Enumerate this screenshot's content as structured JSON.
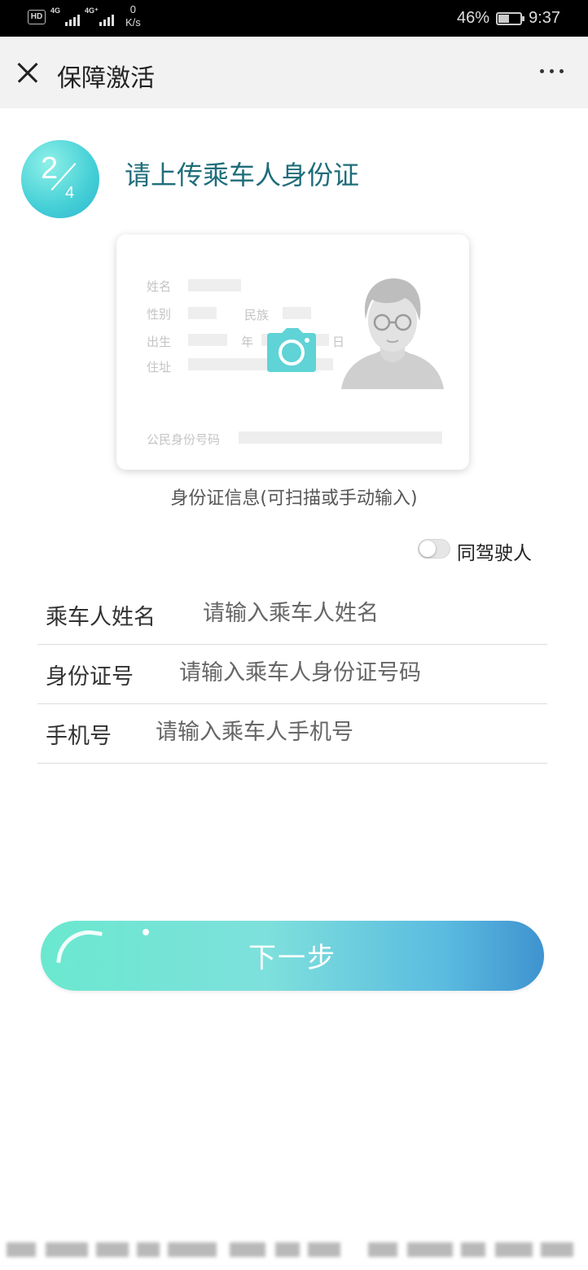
{
  "status_bar": {
    "hd": "HD",
    "sim1": "4G",
    "sim2": "4G⁺",
    "speed_value": "0",
    "speed_unit": "K/s",
    "battery": "46%",
    "battery_level": 0.46,
    "time": "9:37"
  },
  "nav": {
    "title": "保障激活",
    "close_icon": "close-icon",
    "more_icon": "more-icon"
  },
  "step": {
    "current": "2",
    "total": "4",
    "title": "请上传乘车人身份证"
  },
  "id_card": {
    "name_label": "姓名",
    "gender_label": "性别",
    "ethnicity_label": "民族",
    "birth_label": "出生",
    "year_label": "年",
    "day_label": "日",
    "address_label": "住址",
    "id_number_label": "公民身份号码",
    "camera_icon": "camera-icon",
    "portrait_icon": "portrait-icon",
    "accent_color": "#5fd3d6"
  },
  "card_caption": "身份证信息(可扫描或手动输入)",
  "same_driver": {
    "label": "同驾驶人",
    "on": false
  },
  "form": {
    "name": {
      "label": "乘车人姓名",
      "placeholder": "请输入乘车人姓名",
      "value": ""
    },
    "id_number": {
      "label": "身份证号",
      "placeholder": "请输入乘车人身份证号码",
      "value": ""
    },
    "phone": {
      "label": "手机号",
      "placeholder": "请输入乘车人手机号",
      "value": ""
    }
  },
  "next_button": {
    "label": "下一步"
  },
  "colors": {
    "title_teal": "#1f6d7a",
    "button_start": "#6ae8cf",
    "button_end": "#3f93cf"
  }
}
